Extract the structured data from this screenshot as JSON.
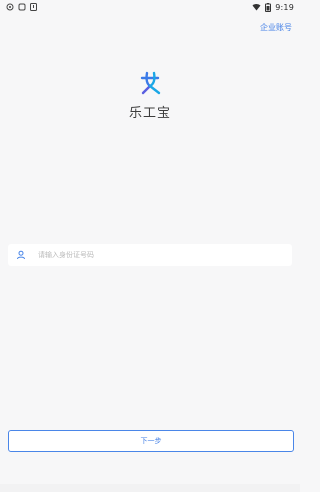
{
  "status_bar": {
    "time": "9:19",
    "left_icons": [
      "notification-icon",
      "settings-icon",
      "alert-icon"
    ],
    "right_icons": [
      "wifi-icon",
      "battery-icon"
    ]
  },
  "header": {
    "enterprise_account_link": "企业账号"
  },
  "brand": {
    "app_name": "乐工宝",
    "logo_colors": {
      "primary": "#3b7be8",
      "secondary": "#1aa7e6"
    }
  },
  "form": {
    "id_field": {
      "icon": "user-icon",
      "value": "",
      "placeholder": "请输入身份证号码"
    },
    "next_button_label": "下一步"
  },
  "colors": {
    "accent": "#3f7de6",
    "background": "#f7f7f8"
  }
}
